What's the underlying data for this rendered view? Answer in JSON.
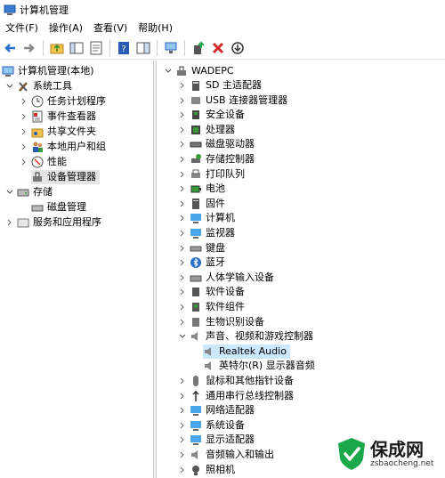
{
  "window": {
    "title": "计算机管理"
  },
  "menu": {
    "items": [
      "文件(F)",
      "操作(A)",
      "查看(V)",
      "帮助(H)"
    ]
  },
  "left_tree": [
    {
      "label": "计算机管理(本地)",
      "indent": 0,
      "toggle": "none",
      "icon": "computer-manage-icon"
    },
    {
      "label": "系统工具",
      "indent": 1,
      "toggle": "open",
      "icon": "tools-icon"
    },
    {
      "label": "任务计划程序",
      "indent": 2,
      "toggle": "closed",
      "icon": "clock-icon"
    },
    {
      "label": "事件查看器",
      "indent": 2,
      "toggle": "closed",
      "icon": "event-viewer-icon"
    },
    {
      "label": "共享文件夹",
      "indent": 2,
      "toggle": "closed",
      "icon": "shared-folder-icon"
    },
    {
      "label": "本地用户和组",
      "indent": 2,
      "toggle": "closed",
      "icon": "users-icon"
    },
    {
      "label": "性能",
      "indent": 2,
      "toggle": "closed",
      "icon": "performance-icon"
    },
    {
      "label": "设备管理器",
      "indent": 2,
      "toggle": "none",
      "icon": "device-manager-icon",
      "selected": true
    },
    {
      "label": "存储",
      "indent": 1,
      "toggle": "open",
      "icon": "storage-icon"
    },
    {
      "label": "磁盘管理",
      "indent": 2,
      "toggle": "none",
      "icon": "disk-icon"
    },
    {
      "label": "服务和应用程序",
      "indent": 1,
      "toggle": "closed",
      "icon": "services-icon"
    }
  ],
  "device_tree": {
    "root": "WADEPC",
    "items": [
      {
        "label": "SD 主适配器",
        "toggle": "closed",
        "icon": "sd-adapter-icon"
      },
      {
        "label": "USB 连接器管理器",
        "toggle": "closed",
        "icon": "usb-icon"
      },
      {
        "label": "安全设备",
        "toggle": "closed",
        "icon": "security-device-icon"
      },
      {
        "label": "处理器",
        "toggle": "closed",
        "icon": "processor-icon"
      },
      {
        "label": "磁盘驱动器",
        "toggle": "closed",
        "icon": "disk-drive-icon"
      },
      {
        "label": "存储控制器",
        "toggle": "closed",
        "icon": "storage-controller-icon"
      },
      {
        "label": "打印队列",
        "toggle": "closed",
        "icon": "printer-icon"
      },
      {
        "label": "电池",
        "toggle": "closed",
        "icon": "battery-icon"
      },
      {
        "label": "固件",
        "toggle": "closed",
        "icon": "firmware-icon"
      },
      {
        "label": "计算机",
        "toggle": "closed",
        "icon": "computer-icon"
      },
      {
        "label": "监视器",
        "toggle": "closed",
        "icon": "monitor-icon"
      },
      {
        "label": "键盘",
        "toggle": "closed",
        "icon": "keyboard-icon"
      },
      {
        "label": "蓝牙",
        "toggle": "closed",
        "icon": "bluetooth-icon"
      },
      {
        "label": "人体学输入设备",
        "toggle": "closed",
        "icon": "hid-icon"
      },
      {
        "label": "软件设备",
        "toggle": "closed",
        "icon": "software-device-icon"
      },
      {
        "label": "软件组件",
        "toggle": "closed",
        "icon": "software-component-icon"
      },
      {
        "label": "生物识别设备",
        "toggle": "closed",
        "icon": "biometric-icon"
      },
      {
        "label": "声音、视频和游戏控制器",
        "toggle": "open",
        "icon": "speaker-icon"
      },
      {
        "label": "Realtek Audio",
        "toggle": "none",
        "icon": "speaker-icon",
        "child": true,
        "selected": true
      },
      {
        "label": "英特尔(R) 显示器音频",
        "toggle": "none",
        "icon": "speaker-icon",
        "child": true
      },
      {
        "label": "鼠标和其他指针设备",
        "toggle": "closed",
        "icon": "mouse-icon"
      },
      {
        "label": "通用串行总线控制器",
        "toggle": "closed",
        "icon": "usb-controller-icon"
      },
      {
        "label": "网络适配器",
        "toggle": "closed",
        "icon": "network-adapter-icon"
      },
      {
        "label": "系统设备",
        "toggle": "closed",
        "icon": "system-device-icon"
      },
      {
        "label": "显示适配器",
        "toggle": "closed",
        "icon": "display-adapter-icon"
      },
      {
        "label": "音频输入和输出",
        "toggle": "closed",
        "icon": "audio-io-icon"
      },
      {
        "label": "照相机",
        "toggle": "closed",
        "icon": "camera-icon"
      }
    ]
  },
  "watermark": {
    "brand": "保成网",
    "domain": "zsbaocheng.net"
  },
  "colors": {
    "accent_green": "#1aa84b",
    "selection_blue": "#cce8ff",
    "selection_grey": "#e5e5e5"
  }
}
